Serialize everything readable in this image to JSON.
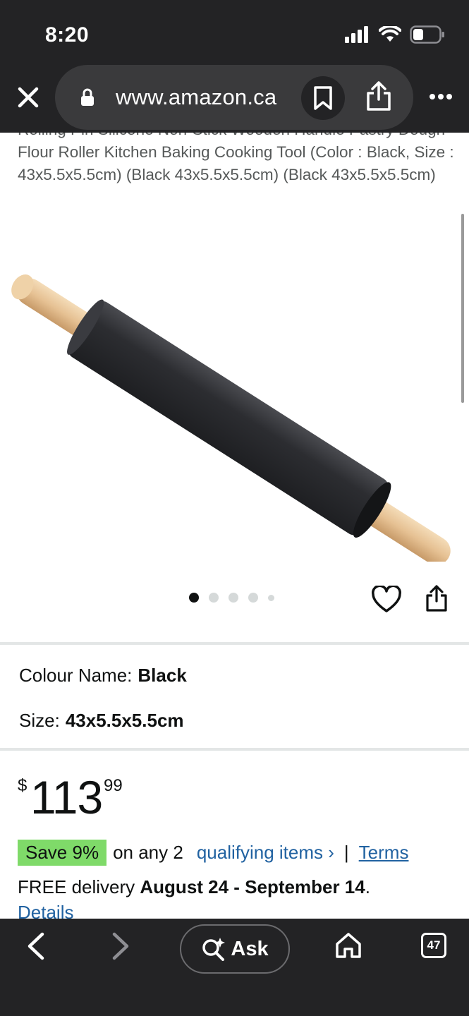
{
  "status_bar": {
    "time": "8:20"
  },
  "browser": {
    "url": "www.amazon.ca",
    "icons": [
      "close-icon",
      "lock-icon",
      "bookmark-icon",
      "share-icon",
      "more-icon"
    ]
  },
  "product": {
    "title_partial": "Rolling Pin Silicone Non-Stick Wooden Handle Pastry Dough Flour Roller Kitchen Baking Cooking Tool (Color : Black, Size : 43x5.5x5.5cm) (Black 43x5.5x5.5cm) (Black 43x5.5x5.5cm)",
    "image_count": 5,
    "active_image_index": 0,
    "colour_label": "Colour Name:",
    "colour_value": "Black",
    "size_label": "Size:",
    "size_value": "43x5.5x5.5cm",
    "price": {
      "currency_symbol": "$",
      "whole": "113",
      "fraction": "99"
    },
    "promo": {
      "badge": "Save 9%",
      "text": "on any 2",
      "link": "qualifying items ›",
      "separator": "|",
      "terms": "Terms"
    },
    "delivery": {
      "prefix": "FREE delivery",
      "dates": "August 24 - September 14",
      "suffix": ".",
      "details_link": "Details"
    }
  },
  "toolbar": {
    "ask_label": "Ask",
    "tab_count": "47"
  },
  "colors": {
    "chrome_bg": "#232325",
    "link": "#2162a1",
    "save_badge": "#7fda69",
    "text": "#0f1111"
  }
}
